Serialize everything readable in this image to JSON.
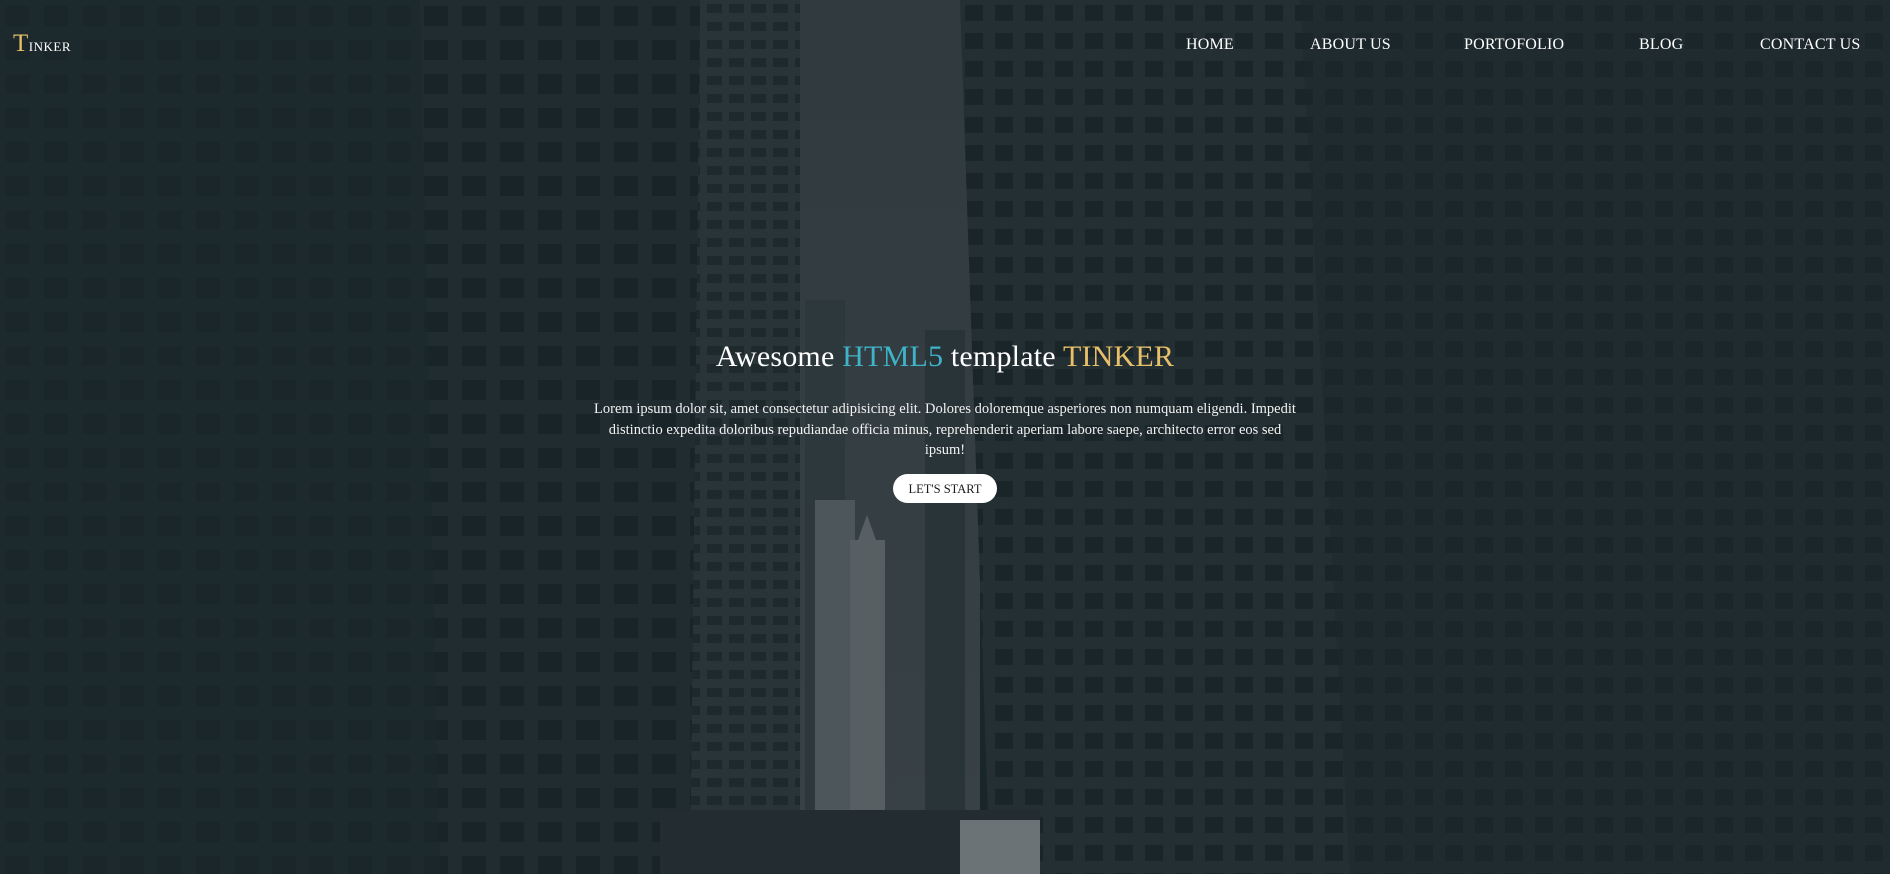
{
  "brand": {
    "initial": "T",
    "rest": "inker"
  },
  "nav": {
    "items": [
      {
        "label": "HOME"
      },
      {
        "label": "ABOUT US"
      },
      {
        "label": "PORTOFOLIO"
      },
      {
        "label": "BLOG"
      },
      {
        "label": "CONTACT US"
      }
    ]
  },
  "hero": {
    "title_part1": "Awesome ",
    "title_part2": "HTML5",
    "title_part3": " template ",
    "title_part4": "TINKER",
    "description": "Lorem ipsum dolor sit, amet consectetur adipisicing elit. Dolores doloremque asperiores non numquam eligendi. Impedit distinctio expedita doloribus repudiandae officia minus, reprehenderit aperiam labore saepe, architecto error eos sed ipsum!",
    "button_label": "LET'S START"
  },
  "colors": {
    "accent_blue": "#3fb3c7",
    "accent_gold": "#e8c06a",
    "overlay": "#1d2a2e"
  }
}
